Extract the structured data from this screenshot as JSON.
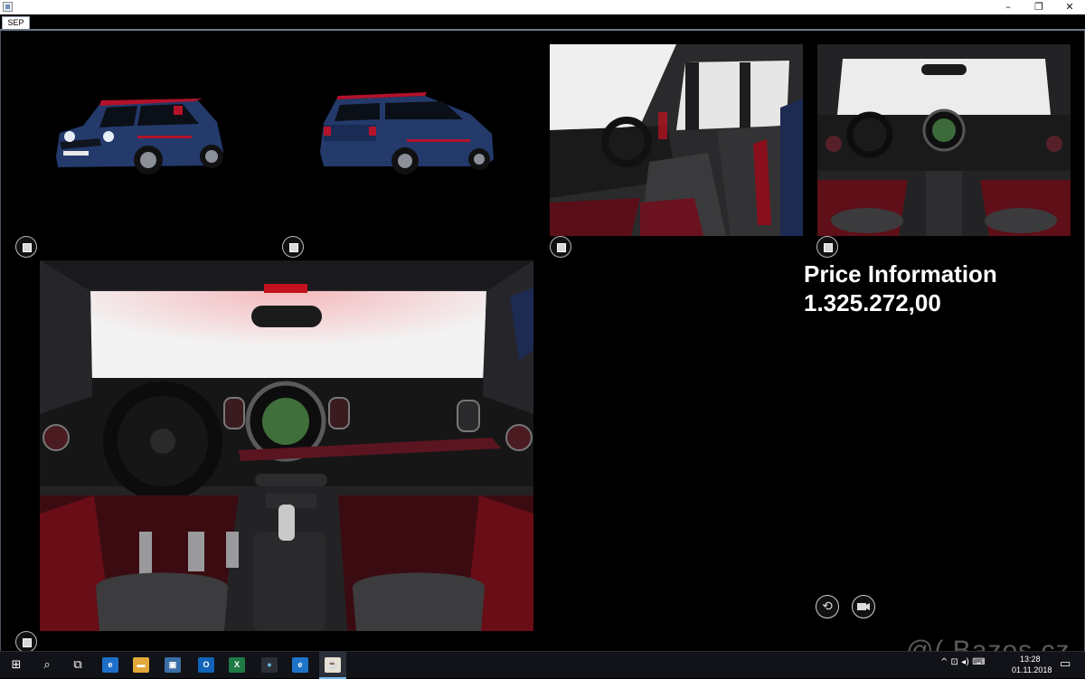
{
  "window": {
    "minimize_glyph": "–",
    "maximize_glyph": "❐",
    "close_glyph": "✕"
  },
  "tabs": [
    {
      "label": "SEP"
    }
  ],
  "price": {
    "title": "Price Information",
    "value": "1.325.272,00"
  },
  "controls": {
    "rotate_icon": "rotate-icon",
    "camera_icon": "video-camera-icon"
  },
  "taskbar": {
    "start_glyph": "⊞",
    "search_glyph": "⌕",
    "taskview_glyph": "⧉",
    "apps": [
      {
        "name": "edge",
        "glyph": "e"
      },
      {
        "name": "file-explorer",
        "glyph": "▬"
      },
      {
        "name": "store",
        "glyph": "▣"
      },
      {
        "name": "outlook",
        "glyph": "O"
      },
      {
        "name": "excel",
        "glyph": "X"
      },
      {
        "name": "app-unknown",
        "glyph": "●"
      },
      {
        "name": "internet-explorer",
        "glyph": "e"
      },
      {
        "name": "java-app",
        "glyph": "☕"
      }
    ],
    "tray_glyphs": "^ ⊡ ◂) ⌨",
    "time": "13:28",
    "date": "01.11.2018",
    "notification_glyph": "▭"
  },
  "watermark": "@( Bazos.cz",
  "colors": {
    "car_body": "#233a6b",
    "car_accent": "#b3122a",
    "ambient_red": "#c4121f",
    "background": "#000000"
  }
}
